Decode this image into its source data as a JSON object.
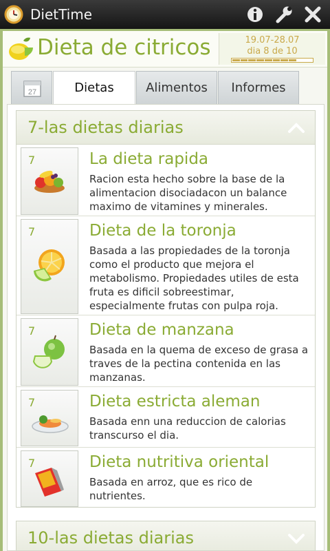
{
  "app": {
    "name": "DietTime"
  },
  "header": {
    "title": "Dieta de citricos",
    "date_range": "19.07-28.07",
    "day_text": "dia 8 de 10",
    "progress_filled_segments": 8,
    "progress_total_segments": 10
  },
  "tabs": [
    {
      "label": "",
      "icon": "calendar-icon",
      "calendar_day": "27"
    },
    {
      "label": "Dietas",
      "active": true
    },
    {
      "label": "Alimentos"
    },
    {
      "label": "Informes"
    }
  ],
  "sections": [
    {
      "title": "7-las dietas diarias",
      "expanded": true,
      "items": [
        {
          "days": "7",
          "title": "La dieta rapida",
          "icon": "fruit-basket-icon",
          "description": "Racion esta hecho sobre la base de la alimentacion disociadacon un balance maximo de vitamines y minerales."
        },
        {
          "days": "7",
          "title": "Dieta de la toronja",
          "icon": "grapefruit-icon",
          "description": "Basada a las propiedades de la toronja como el producto que mejora el metabolismo. Propiedades utiles de esta fruta es dificil sobreestimar, especialmente frutas con pulpa roja."
        },
        {
          "days": "7",
          "title": "Dieta de manzana",
          "icon": "apple-icon",
          "description": "Basada en la quema de exceso de grasa a traves de la pectina contenida en las manzanas."
        },
        {
          "days": "7",
          "title": "Dieta estricta aleman",
          "icon": "plate-icon",
          "description": "Basada enn una reduccion de calorias transcurso el dia."
        },
        {
          "days": "7",
          "title": "Dieta nutritiva oriental",
          "icon": "rice-package-icon",
          "description": "Basada en arroz, que es rico de nutrientes."
        }
      ]
    },
    {
      "title": "10-las dietas diarias",
      "expanded": false
    }
  ],
  "colors": {
    "accent": "#8aab34",
    "frame": "#a6bd78",
    "date": "#c9a94a"
  }
}
